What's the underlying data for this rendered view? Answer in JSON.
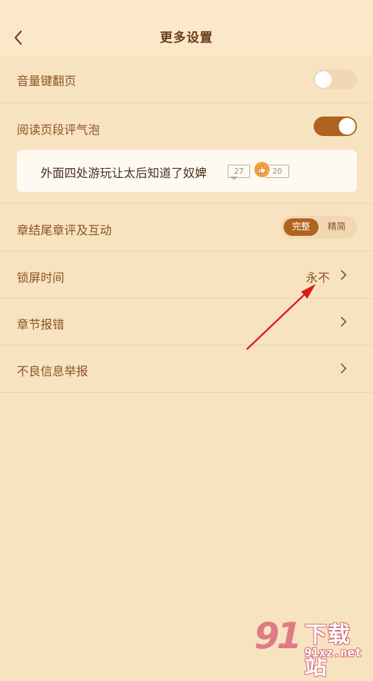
{
  "header": {
    "title": "更多设置",
    "back_icon": "chevron-left-icon"
  },
  "settings": {
    "volume_page_turn": {
      "label": "音量键翻页",
      "enabled": false
    },
    "paragraph_bubbles": {
      "label": "阅读页段评气泡",
      "enabled": true,
      "preview": {
        "text": "外面四处游玩让太后知道了奴婢",
        "comment_count": "27",
        "like_count": "20"
      }
    },
    "chapter_end": {
      "label": "章结尾章评及互动",
      "options": [
        "完整",
        "精简"
      ],
      "selected": "完整"
    },
    "lock_screen": {
      "label": "锁屏时间",
      "value": "永不"
    },
    "chapter_error": {
      "label": "章节报错"
    },
    "report_bad_info": {
      "label": "不良信息举报"
    }
  },
  "colors": {
    "background": "#f8e3c0",
    "accent": "#b0631f",
    "text": "#8a5427",
    "annotation_arrow": "#d81e1e"
  },
  "watermark": {
    "logo_text": "91",
    "site_name": "下载站",
    "url": "91xz.net"
  }
}
